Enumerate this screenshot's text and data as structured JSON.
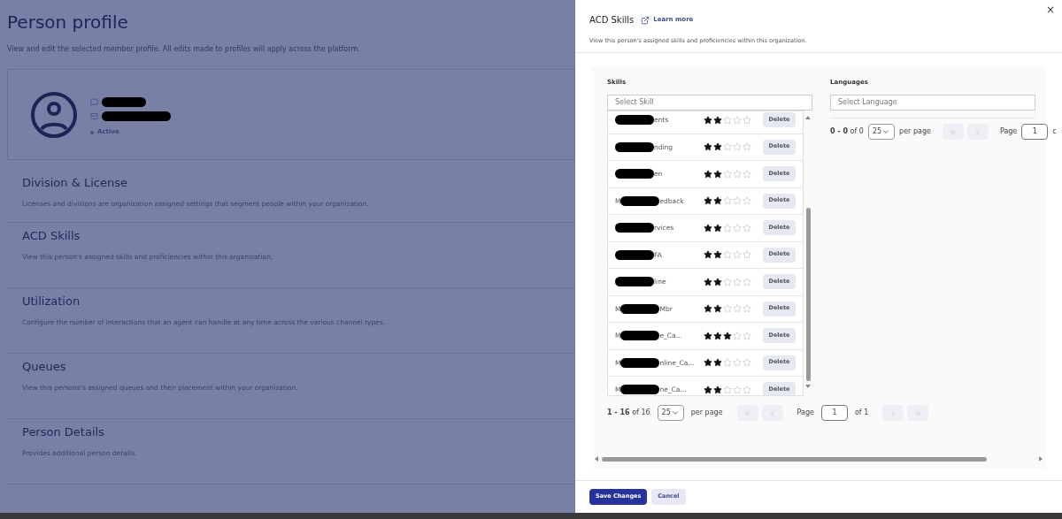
{
  "page": {
    "title": "Person profile",
    "description": "View and edit the selected member profile. All edits made to profiles will apply across the platform."
  },
  "profile": {
    "status": "Active"
  },
  "sections": [
    {
      "title": "Division & License",
      "description": "Licenses and divisions are organization assigned settings that segment people within your organization."
    },
    {
      "title": "ACD Skills",
      "description": "View this person's assigned skills and proficiencies within this organization."
    },
    {
      "title": "Utilization",
      "description": "Configure the number of interactions that an agent can handle at any time across the various channel types."
    },
    {
      "title": "Queues",
      "description": "View this persons's assigned queues and their placement within your organization."
    },
    {
      "title": "Person Details",
      "description": "Provides additional person details."
    }
  ],
  "drawer": {
    "title": "ACD Skills",
    "link": "Learn more",
    "close": "×",
    "description": "View this person's assigned skills and proficiencies within this organization.",
    "skills": {
      "label": "Skills",
      "placeholder": "Select Skill",
      "rows": [
        {
          "prefix": "",
          "suffix": "ents",
          "stars": 2,
          "action": "Delete"
        },
        {
          "prefix": "",
          "suffix": "nding",
          "stars": 2,
          "action": "Delete"
        },
        {
          "prefix": "",
          "suffix": "en",
          "stars": 2,
          "action": "Delete"
        },
        {
          "prefix": "M",
          "suffix": "edback",
          "stars": 2,
          "action": "Delete"
        },
        {
          "prefix": "",
          "suffix": "rvices",
          "stars": 2,
          "action": "Delete"
        },
        {
          "prefix": "",
          "suffix": "FA",
          "stars": 2,
          "action": "Delete"
        },
        {
          "prefix": "",
          "suffix": "line",
          "stars": 2,
          "action": "Delete"
        },
        {
          "prefix": "M",
          "suffix": "Mbr",
          "stars": 2,
          "action": "Delete"
        },
        {
          "prefix": "M",
          "suffix": "e_Ca...",
          "stars": 3,
          "action": "Delete"
        },
        {
          "prefix": "M",
          "suffix": "nline_Ca...",
          "stars": 2,
          "action": "Delete"
        },
        {
          "prefix": "M",
          "suffix": "ne_Ca...",
          "stars": 2,
          "action": "Delete"
        }
      ],
      "pagination": {
        "range": "**1 - 16** of 16",
        "per_page_value": "25",
        "per_page": "per page",
        "page_label": "Page",
        "page": "1",
        "of": "of 1"
      }
    },
    "languages": {
      "label": "Languages",
      "placeholder": "Select Language",
      "pagination": {
        "range": "**0 - 0** of 0",
        "per_page_value": "25",
        "per_page": "per page",
        "page_label": "Page",
        "page": "1",
        "of": "c"
      }
    },
    "buttons": [
      {
        "label": "Save Changes",
        "kind": "primary"
      },
      {
        "label": "Cancel",
        "kind": "secondary"
      }
    ]
  }
}
